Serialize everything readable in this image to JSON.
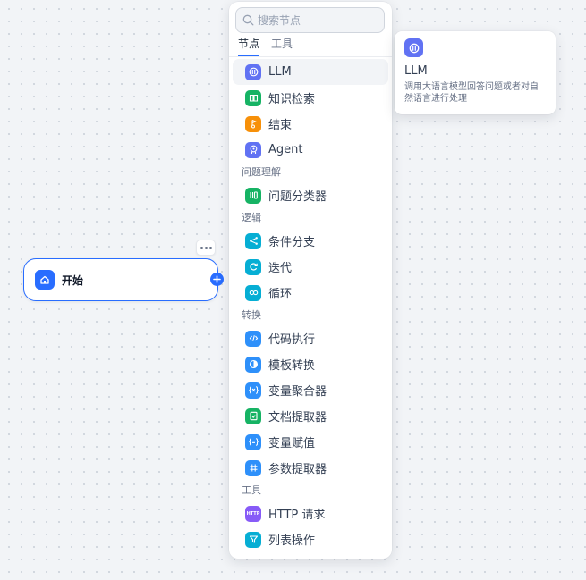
{
  "canvas": {
    "start_node": {
      "label": "开始",
      "icon": "home-icon",
      "color": "#296dff"
    },
    "more_icon": "more-dots-icon",
    "add_icon": "plus-icon"
  },
  "picker": {
    "search": {
      "placeholder": "搜索节点",
      "value": ""
    },
    "tabs": [
      {
        "label": "节点",
        "active": true
      },
      {
        "label": "工具",
        "active": false
      }
    ],
    "groups": [
      {
        "title": "",
        "items": [
          {
            "label": "LLM",
            "icon": "llm-icon",
            "color": "#6172f3",
            "hovered": true
          },
          {
            "label": "知识检索",
            "icon": "book-icon",
            "color": "#16b364"
          },
          {
            "label": "结束",
            "icon": "end-flag-icon",
            "color": "#f79009"
          },
          {
            "label": "Agent",
            "icon": "agent-icon",
            "color": "#6172f3"
          }
        ]
      },
      {
        "title": "问题理解",
        "items": [
          {
            "label": "问题分类器",
            "icon": "classifier-icon",
            "color": "#16b364"
          }
        ]
      },
      {
        "title": "逻辑",
        "items": [
          {
            "label": "条件分支",
            "icon": "branch-icon",
            "color": "#06aed4"
          },
          {
            "label": "迭代",
            "icon": "iteration-icon",
            "color": "#06aed4"
          },
          {
            "label": "循环",
            "icon": "loop-icon",
            "color": "#06aed4"
          }
        ]
      },
      {
        "title": "转换",
        "items": [
          {
            "label": "代码执行",
            "icon": "code-icon",
            "color": "#2e90fa"
          },
          {
            "label": "模板转换",
            "icon": "template-icon",
            "color": "#2e90fa"
          },
          {
            "label": "变量聚合器",
            "icon": "variable-aggregator-icon",
            "color": "#2e90fa"
          },
          {
            "label": "文档提取器",
            "icon": "document-extractor-icon",
            "color": "#16b364"
          },
          {
            "label": "变量赋值",
            "icon": "variable-assign-icon",
            "color": "#2e90fa"
          },
          {
            "label": "参数提取器",
            "icon": "parameter-extractor-icon",
            "color": "#2e90fa"
          }
        ]
      },
      {
        "title": "工具",
        "items": [
          {
            "label": "HTTP 请求",
            "icon": "http-icon",
            "color": "#875bf7",
            "badge": "HTTP"
          },
          {
            "label": "列表操作",
            "icon": "list-filter-icon",
            "color": "#06aed4"
          }
        ]
      }
    ]
  },
  "tooltip": {
    "title": "LLM",
    "icon": "llm-icon",
    "color": "#6172f3",
    "description": "调用大语言模型回答问题或者对自然语言进行处理"
  }
}
